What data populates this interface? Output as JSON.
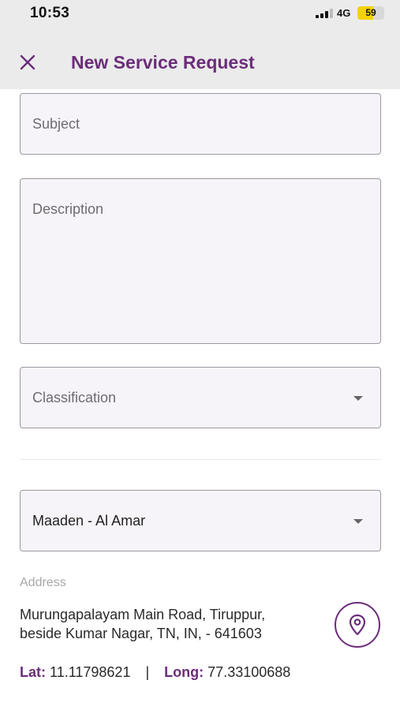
{
  "status_bar": {
    "time": "10:53",
    "network": "4G",
    "battery": "59",
    "battery_level": 0.59,
    "battery_color": "#f4d20a"
  },
  "header": {
    "close_icon": "close-icon",
    "title": "New Service Request"
  },
  "form": {
    "subject_placeholder": "Subject",
    "description_placeholder": "Description",
    "classification_placeholder": "Classification",
    "site_value": "Maaden - Al Amar"
  },
  "address": {
    "label": "Address",
    "line1": "Murungapalayam Main Road, Tiruppur,",
    "line2": "beside Kumar Nagar, TN, IN, - 641603",
    "location_icon": "location-pin-icon"
  },
  "coordinates": {
    "lat_label": "Lat:",
    "lat_value": "11.11798621",
    "separator": "|",
    "long_label": "Long:",
    "long_value": "77.33100688"
  },
  "colors": {
    "accent": "#6b2d7a",
    "header_bg": "#ebebeb",
    "field_bg": "#f7f4f9"
  }
}
